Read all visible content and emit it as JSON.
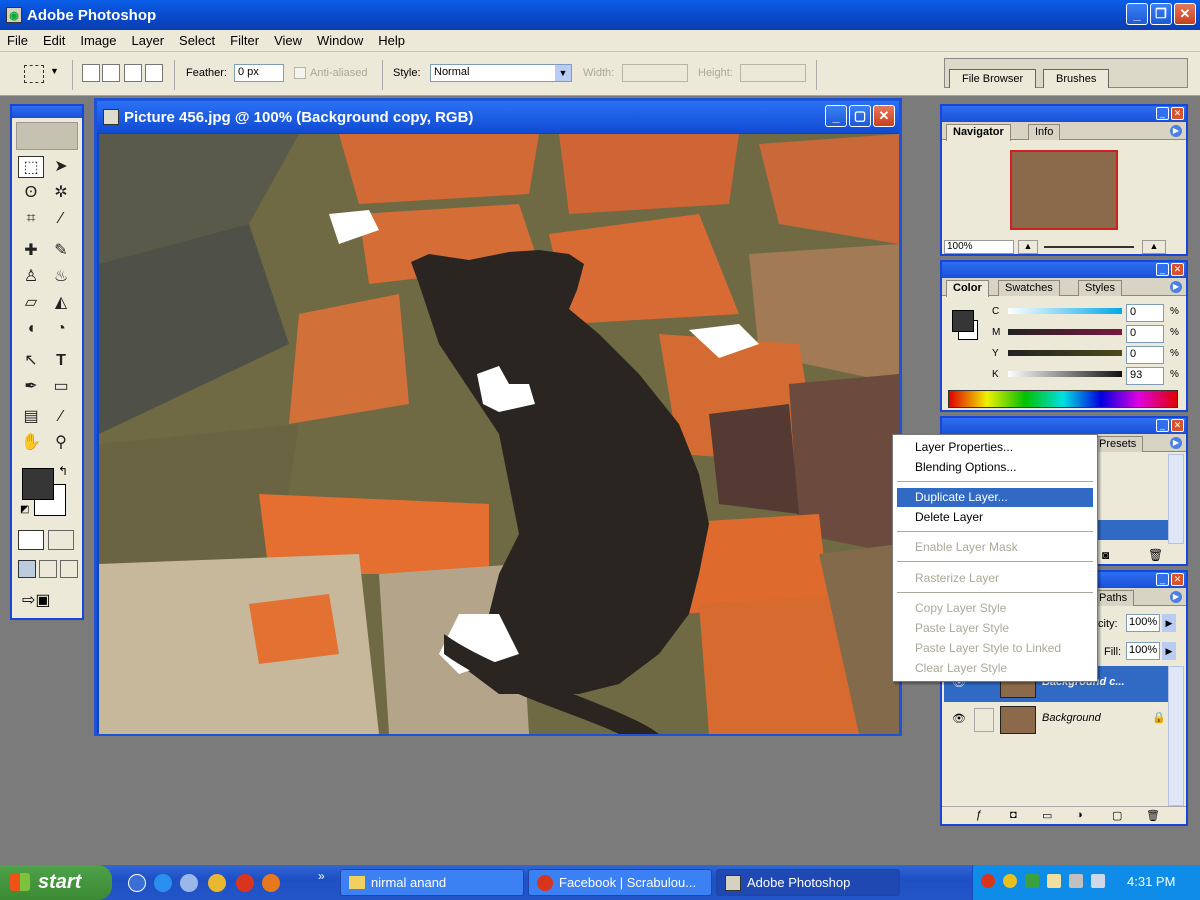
{
  "app": {
    "title": "Adobe Photoshop",
    "win_min": "_",
    "win_max": "❐",
    "win_close": "✕"
  },
  "menu": [
    "File",
    "Edit",
    "Image",
    "Layer",
    "Select",
    "Filter",
    "View",
    "Window",
    "Help"
  ],
  "options": {
    "feather_label": "Feather:",
    "feather_value": "0 px",
    "antialias_label": "Anti-aliased",
    "style_label": "Style:",
    "style_value": "Normal",
    "width_label": "Width:",
    "height_label": "Height:",
    "well_tabs": [
      "File Browser",
      "Brushes"
    ]
  },
  "document": {
    "title": "Picture 456.jpg @ 100% (Background copy, RGB)"
  },
  "navigator": {
    "tabs": [
      "Navigator",
      "Info"
    ],
    "zoom": "100%"
  },
  "color": {
    "tabs": [
      "Color",
      "Swatches",
      "Styles"
    ],
    "channels": [
      {
        "label": "C",
        "value": "0",
        "unit": "%"
      },
      {
        "label": "M",
        "value": "0",
        "unit": "%"
      },
      {
        "label": "Y",
        "value": "0",
        "unit": "%"
      },
      {
        "label": "K",
        "value": "93",
        "unit": "%"
      }
    ]
  },
  "history_panel": {
    "partial_tab": "Presets"
  },
  "layers": {
    "partial_tab": "Paths",
    "opacity_label": "city:",
    "opacity_value": "100%",
    "fill_label": "Fill:",
    "fill_value": "100%",
    "rows": [
      {
        "name": "Background c...",
        "selected": true
      },
      {
        "name": "Background",
        "selected": false
      }
    ]
  },
  "context_menu": [
    {
      "label": "Layer Properties...",
      "state": "normal"
    },
    {
      "label": "Blending Options...",
      "state": "normal"
    },
    {
      "label": "Duplicate Layer...",
      "state": "highlighted"
    },
    {
      "label": "Delete Layer",
      "state": "normal"
    },
    {
      "label": "Enable Layer Mask",
      "state": "disabled"
    },
    {
      "label": "Rasterize Layer",
      "state": "disabled"
    },
    {
      "label": "Copy Layer Style",
      "state": "disabled"
    },
    {
      "label": "Paste Layer Style",
      "state": "disabled"
    },
    {
      "label": "Paste Layer Style to Linked",
      "state": "disabled"
    },
    {
      "label": "Clear Layer Style",
      "state": "disabled"
    }
  ],
  "taskbar": {
    "start": "start",
    "tasks": [
      {
        "label": "nirmal anand",
        "active": false
      },
      {
        "label": "Facebook | Scrabulou...",
        "active": false
      },
      {
        "label": "Adobe Photoshop",
        "active": true
      }
    ],
    "clock": "4:31 PM",
    "overflow": "»"
  },
  "colors": {
    "accent": "#316ac5",
    "titlebar": "#0a5ee8",
    "start_green": "#3a8a33"
  }
}
